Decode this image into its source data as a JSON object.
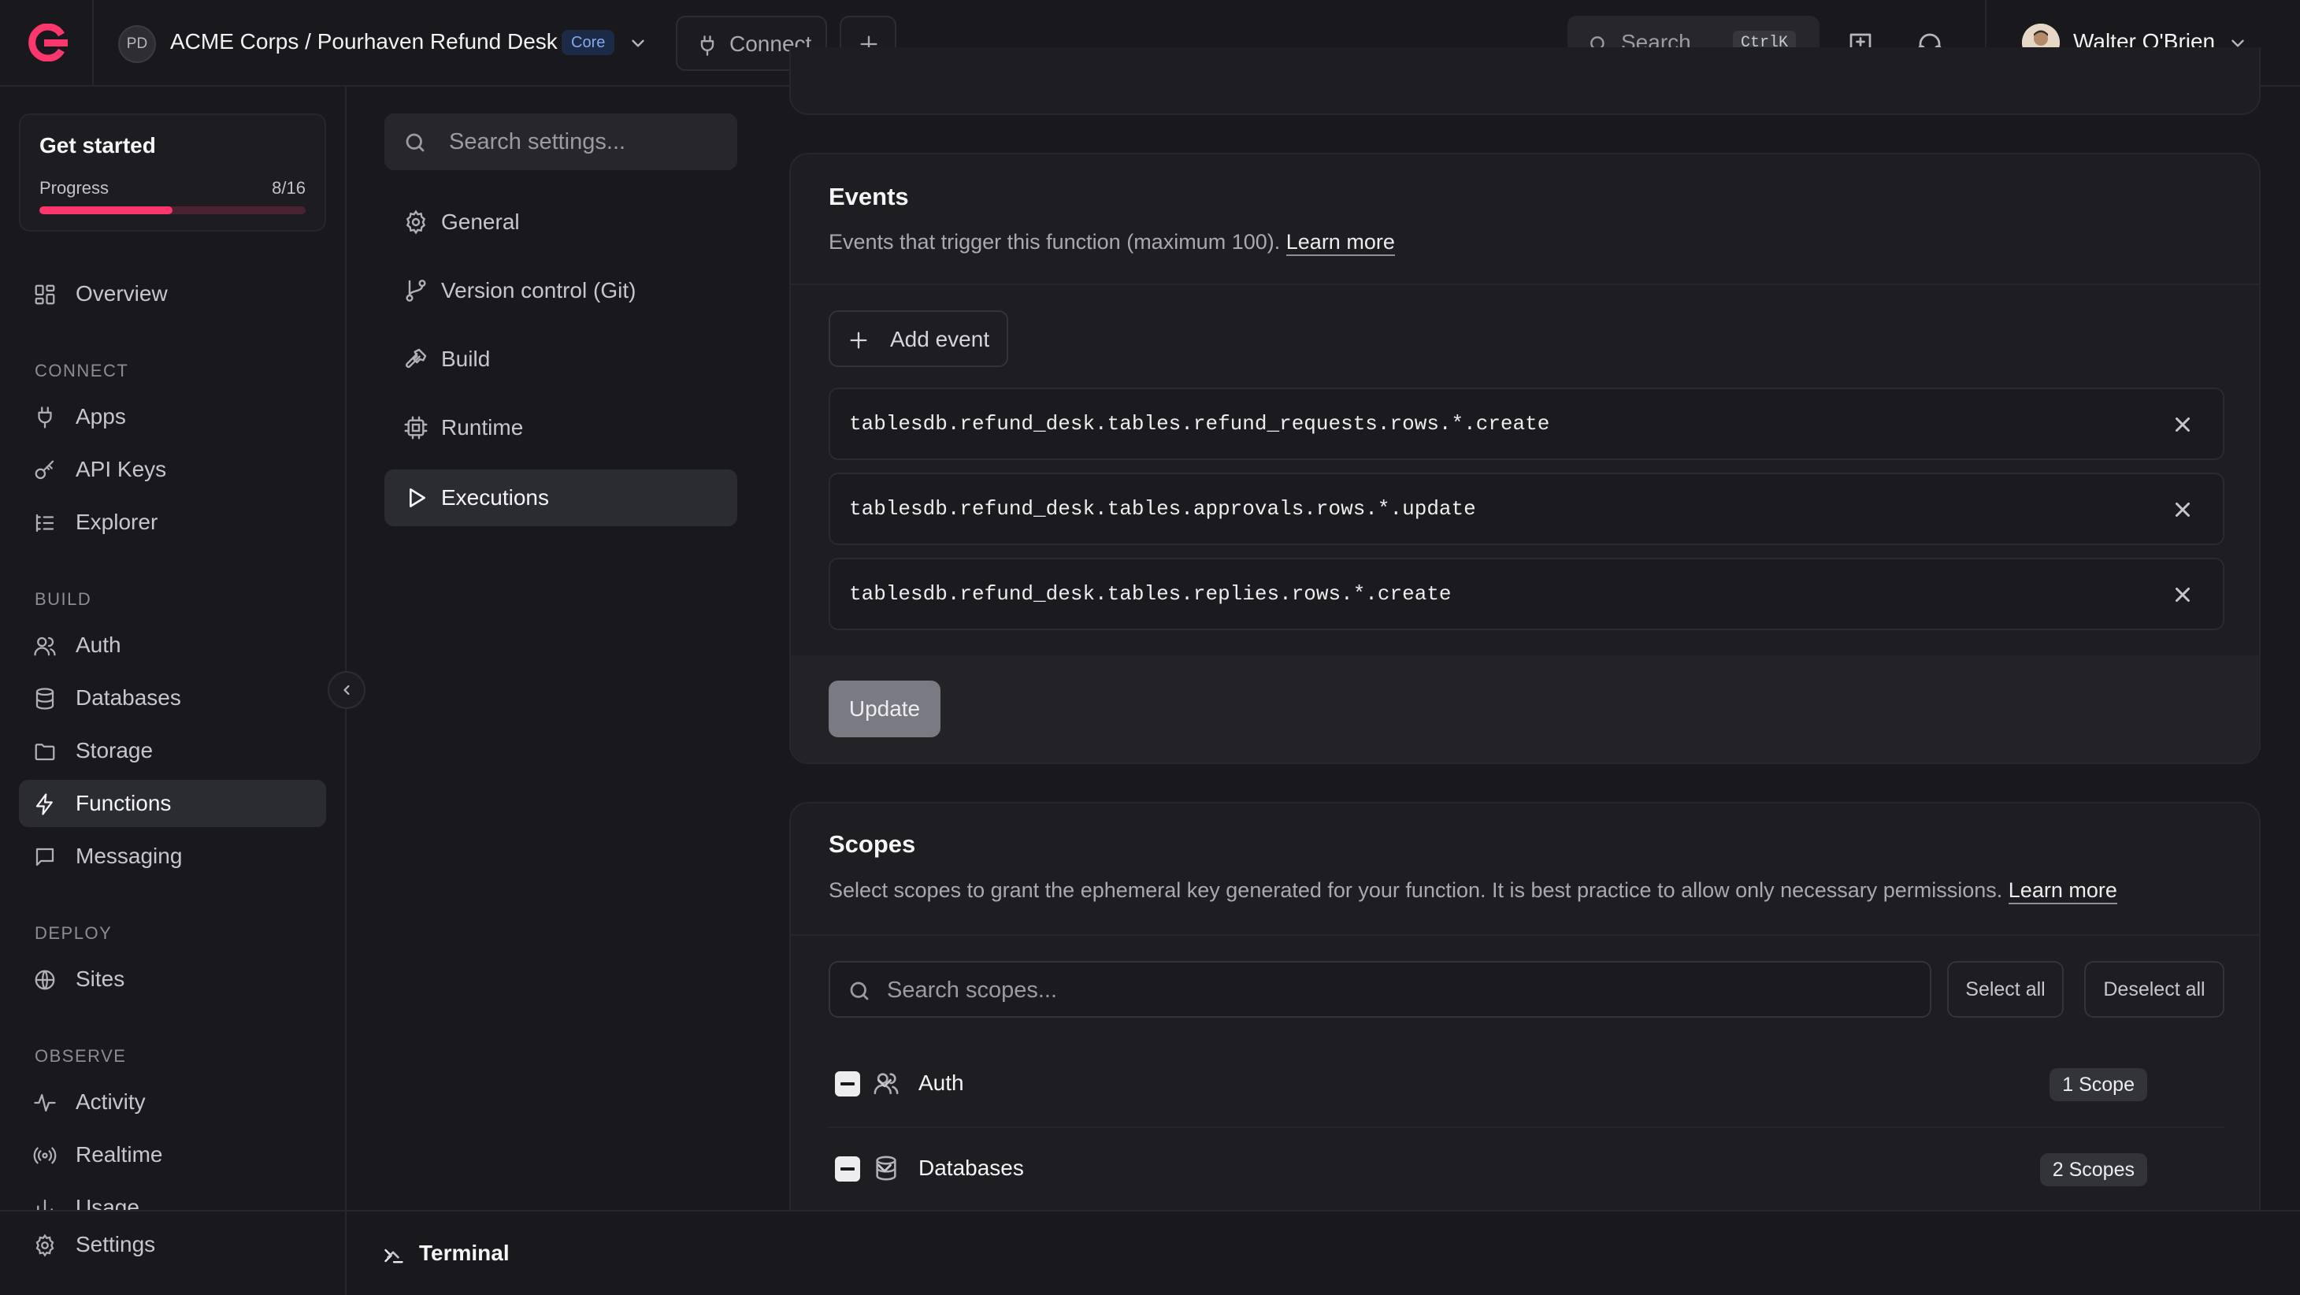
{
  "topbar": {
    "org_initials": "PD",
    "org_title": "ACME Corps / Pourhaven Refund Desk",
    "plan_badge": "Core",
    "connect_label": "Connect",
    "search_placeholder": "Search...",
    "search_shortcut": "CtrlK",
    "user_name": "Walter O'Brien"
  },
  "get_started": {
    "title": "Get started",
    "progress_label": "Progress",
    "progress_count": "8/16",
    "progress_fraction": 0.5
  },
  "sidebar": {
    "overview": "Overview",
    "sections": {
      "connect": "CONNECT",
      "build": "BUILD",
      "deploy": "DEPLOY",
      "observe": "OBSERVE"
    },
    "items": {
      "apps": "Apps",
      "api_keys": "API Keys",
      "explorer": "Explorer",
      "auth": "Auth",
      "databases": "Databases",
      "storage": "Storage",
      "functions": "Functions",
      "messaging": "Messaging",
      "sites": "Sites",
      "activity": "Activity",
      "realtime": "Realtime",
      "usage": "Usage",
      "settings": "Settings"
    }
  },
  "settings_nav": {
    "search_placeholder": "Search settings...",
    "items": {
      "general": "General",
      "version_control": "Version control (Git)",
      "build": "Build",
      "runtime": "Runtime",
      "executions": "Executions"
    }
  },
  "events": {
    "title": "Events",
    "description": "Events that trigger this function (maximum 100).",
    "learn_more": "Learn more",
    "add_event": "Add event",
    "list": [
      "tablesdb.refund_desk.tables.refund_requests.rows.*.create",
      "tablesdb.refund_desk.tables.approvals.rows.*.update",
      "tablesdb.refund_desk.tables.replies.rows.*.create"
    ],
    "update_label": "Update"
  },
  "scopes": {
    "title": "Scopes",
    "description": "Select scopes to grant the ephemeral key generated for your function. It is best practice to allow only necessary permissions.",
    "learn_more": "Learn more",
    "search_placeholder": "Search scopes...",
    "select_all": "Select all",
    "deselect_all": "Deselect all",
    "groups": [
      {
        "name": "Auth",
        "count_label": "1 Scope"
      },
      {
        "name": "Databases",
        "count_label": "2 Scopes"
      }
    ]
  },
  "terminal": {
    "label": "Terminal"
  },
  "colors": {
    "accent": "#fd366e",
    "background": "#19191d",
    "card": "#1d1d22"
  }
}
